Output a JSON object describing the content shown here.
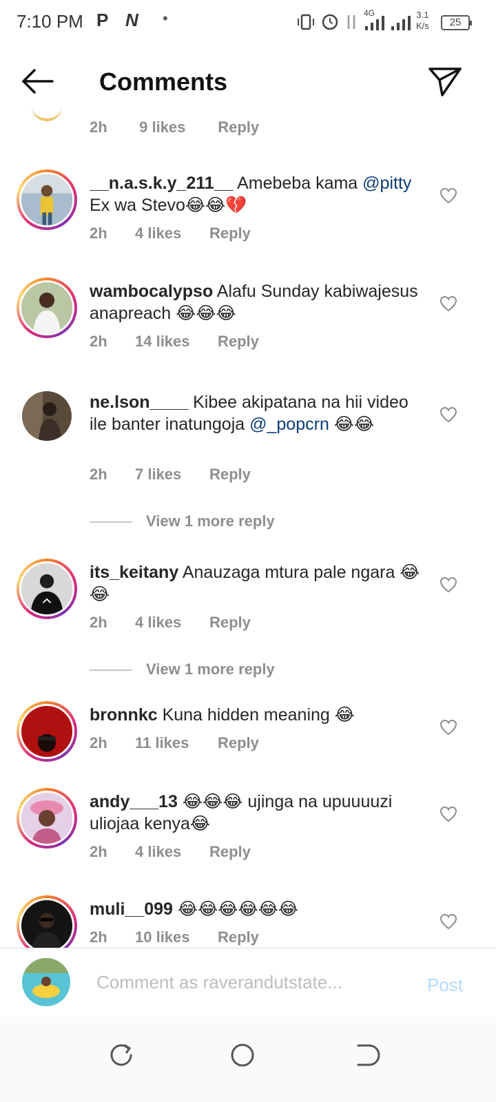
{
  "status_bar": {
    "time": "7:10 PM",
    "app_icons": [
      "P",
      "N"
    ],
    "net_speed_value": "3.1",
    "net_speed_unit": "K/s",
    "network": "4G",
    "battery": "25"
  },
  "header": {
    "title": "Comments"
  },
  "partial_comment": {
    "time": "2h",
    "likes": "9 likes",
    "reply": "Reply"
  },
  "comments": [
    {
      "username": "__n.a.s.k.y_211__",
      "text_before": " Amebeba kama ",
      "mention": "@pitty",
      "text_after": " Ex wa Stevo😂😂💔",
      "time": "2h",
      "likes": "4 likes",
      "reply": "Reply"
    },
    {
      "username": "wambocalypso",
      "text_before": " Alafu Sunday kabiwajesus  anapreach 😂😂😂",
      "time": "2h",
      "likes": "14 likes",
      "reply": "Reply"
    },
    {
      "username": "ne.lson____",
      "text_before": " Kibee akipatana na hii video ile banter inatungoja ",
      "mention": "@_popcrn",
      "text_after": " 😂😂",
      "time": "2h",
      "likes": "7 likes",
      "reply": "Reply",
      "view_more": "View 1 more reply"
    },
    {
      "username": "its_keitany",
      "text_before": " Anauzaga mtura pale ngara 😂😂",
      "time": "2h",
      "likes": "4 likes",
      "reply": "Reply",
      "view_more": "View 1 more reply"
    },
    {
      "username": "bronnkc",
      "text_before": " Kuna hidden meaning 😂",
      "time": "2h",
      "likes": "11 likes",
      "reply": "Reply"
    },
    {
      "username": "andy___13",
      "text_before": " 😂😂😂 ujinga na upuuuuzi uliojaa kenya😂",
      "time": "2h",
      "likes": "4 likes",
      "reply": "Reply"
    },
    {
      "username": "muli__099",
      "text_before": " 😂😂😂😂😂😂",
      "time": "2h",
      "likes": "10 likes",
      "reply": "Reply"
    }
  ],
  "composer": {
    "placeholder": "Comment as raverandutstate...",
    "post_label": "Post"
  },
  "icons": {
    "back": "arrow-left-icon",
    "send": "paper-plane-icon",
    "like": "heart-outline-icon",
    "nav_recents": "recents-icon",
    "nav_home": "home-circle-icon",
    "nav_back": "back-nav-icon"
  },
  "colors": {
    "mention": "#0c3c78",
    "meta_gray": "#8e8e8e",
    "post_disabled": "#b3dbff"
  }
}
